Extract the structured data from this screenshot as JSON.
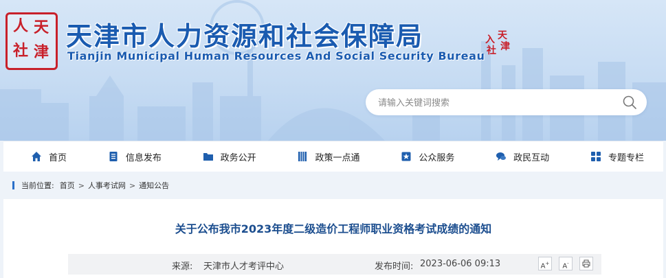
{
  "header": {
    "title": "天津市人力资源和社会保障局",
    "subtitle": "Tianjin Municipal Human Resources And Social Security Bureau",
    "seal_left": [
      "人",
      "天",
      "社",
      "津"
    ],
    "seal_right": [
      "天",
      "津",
      "入",
      "社"
    ],
    "search_placeholder": "请输入关键词搜索",
    "search_value": ""
  },
  "nav": {
    "items": [
      {
        "label": "首页",
        "icon": "home-icon"
      },
      {
        "label": "信息发布",
        "icon": "document-icon"
      },
      {
        "label": "政务公开",
        "icon": "folder-icon"
      },
      {
        "label": "政策一点通",
        "icon": "book-icon"
      },
      {
        "label": "公众服务",
        "icon": "star-badge-icon"
      },
      {
        "label": "政民互动",
        "icon": "chat-icon"
      },
      {
        "label": "专题专栏",
        "icon": "grid-icon"
      }
    ]
  },
  "breadcrumb": {
    "label": "当前位置:",
    "items": [
      "首页",
      "人事考试网",
      "通知公告"
    ],
    "separator": ">"
  },
  "article": {
    "title": "关于公布我市2023年度二级造价工程师职业资格考试成绩的通知",
    "source_label": "来源:",
    "source_value": "天津市人才考评中心",
    "time_label": "发布时间:",
    "time_value": "2023-06-06 09:13",
    "tools": [
      "A+",
      "A-",
      "print"
    ]
  },
  "colors": {
    "accent": "#1a5bb0",
    "seal_red": "#c8202a",
    "title_blue": "#1c4e8f"
  }
}
